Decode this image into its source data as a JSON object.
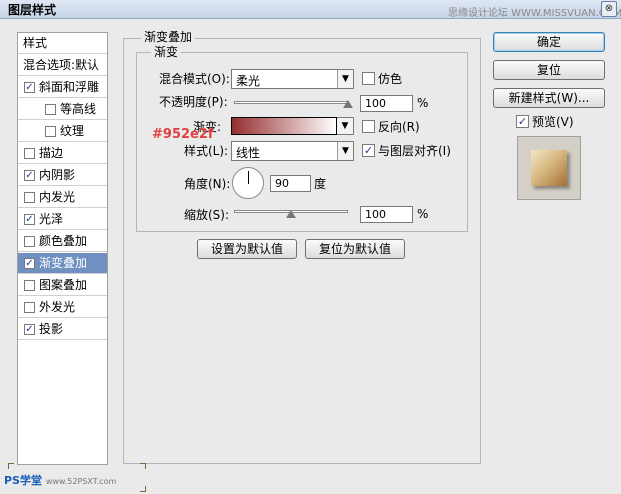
{
  "window": {
    "title": "图层样式",
    "watermark_top": "思缘设计论坛  WWW.MISSVUAN.COM",
    "close_glyph": "⊗"
  },
  "left_panel": {
    "items": [
      {
        "label": "样式",
        "checkbox": false,
        "checked": false,
        "selected": false
      },
      {
        "label": "混合选项:默认",
        "checkbox": false,
        "checked": false,
        "selected": false
      },
      {
        "label": "斜面和浮雕",
        "checkbox": true,
        "checked": true,
        "selected": false
      },
      {
        "label": "等高线",
        "checkbox": true,
        "checked": false,
        "selected": false,
        "indent": true
      },
      {
        "label": "纹理",
        "checkbox": true,
        "checked": false,
        "selected": false,
        "indent": true
      },
      {
        "label": "描边",
        "checkbox": true,
        "checked": false,
        "selected": false
      },
      {
        "label": "内阴影",
        "checkbox": true,
        "checked": true,
        "selected": false
      },
      {
        "label": "内发光",
        "checkbox": true,
        "checked": false,
        "selected": false
      },
      {
        "label": "光泽",
        "checkbox": true,
        "checked": true,
        "selected": false
      },
      {
        "label": "颜色叠加",
        "checkbox": true,
        "checked": false,
        "selected": false
      },
      {
        "label": "渐变叠加",
        "checkbox": true,
        "checked": true,
        "selected": true
      },
      {
        "label": "图案叠加",
        "checkbox": true,
        "checked": false,
        "selected": false
      },
      {
        "label": "外发光",
        "checkbox": true,
        "checked": false,
        "selected": false
      },
      {
        "label": "投影",
        "checkbox": true,
        "checked": true,
        "selected": false
      }
    ]
  },
  "gradient_overlay": {
    "group_title": "渐变叠加",
    "subgroup_title": "渐变",
    "blend_mode_label": "混合模式(O):",
    "blend_mode_value": "柔光",
    "dither_label": "仿色",
    "dither_checked": false,
    "opacity_label": "不透明度(P):",
    "opacity_value": "100",
    "opacity_unit": "%",
    "opacity_level": 1.0,
    "gradient_label": "渐变:",
    "gradient_color_start": "#952e2f",
    "gradient_color_end": "#ffffff",
    "reverse_label": "反向(R)",
    "reverse_checked": false,
    "hex_note": "#952e2f",
    "style_label": "样式(L):",
    "style_value": "线性",
    "align_label": "与图层对齐(I)",
    "align_checked": true,
    "angle_label": "角度(N):",
    "angle_value": "90",
    "angle_unit": "度",
    "scale_label": "缩放(S):",
    "scale_value": "100",
    "scale_unit": "%",
    "scale_level": 0.5,
    "set_default_button": "设置为默认值",
    "reset_default_button": "复位为默认值"
  },
  "right_buttons": {
    "ok": "确定",
    "reset": "复位",
    "new_style": "新建样式(W)...",
    "preview_label": "预览(V)",
    "preview_checked": true
  },
  "bottom_logo": {
    "text": "PS学堂",
    "url": "www.52PSXT.com"
  }
}
